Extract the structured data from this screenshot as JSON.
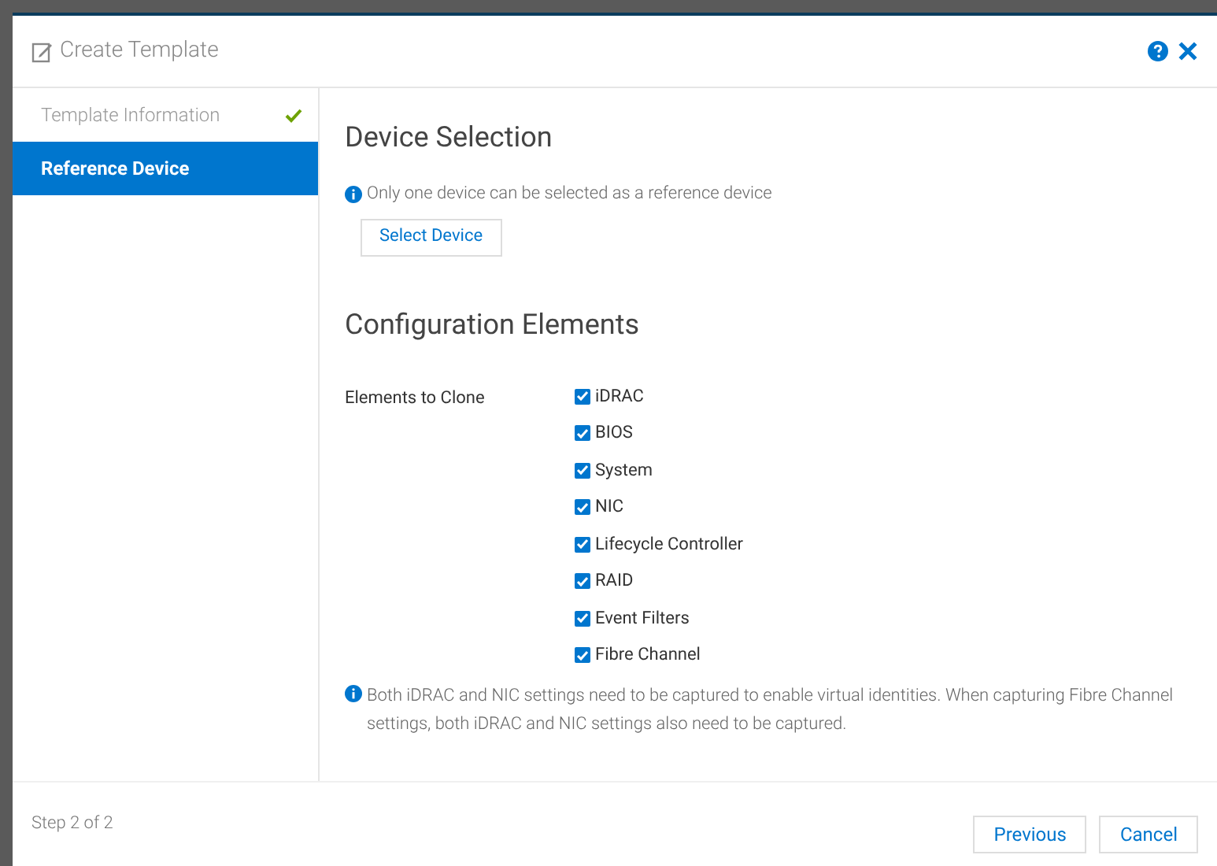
{
  "dialog": {
    "title": "Create Template"
  },
  "steps": [
    {
      "label": "Template Information",
      "selected": false,
      "completed": true
    },
    {
      "label": "Reference Device",
      "selected": true,
      "completed": false
    }
  ],
  "device_selection": {
    "heading": "Device Selection",
    "info": "Only one device can be selected as a reference device",
    "button": "Select Device"
  },
  "configuration": {
    "heading": "Configuration Elements",
    "label": "Elements to Clone",
    "elements": [
      {
        "label": "iDRAC",
        "checked": true
      },
      {
        "label": "BIOS",
        "checked": true
      },
      {
        "label": "System",
        "checked": true
      },
      {
        "label": "NIC",
        "checked": true
      },
      {
        "label": "Lifecycle Controller",
        "checked": true
      },
      {
        "label": "RAID",
        "checked": true
      },
      {
        "label": "Event Filters",
        "checked": true
      },
      {
        "label": "Fibre Channel",
        "checked": true
      }
    ],
    "note": "Both iDRAC and NIC settings need to be captured to enable virtual identities. When capturing Fibre Channel settings, both iDRAC and NIC settings also need to be captured."
  },
  "footer": {
    "step": "Step 2 of 2",
    "buttons": [
      "Previous",
      "Cancel"
    ]
  }
}
